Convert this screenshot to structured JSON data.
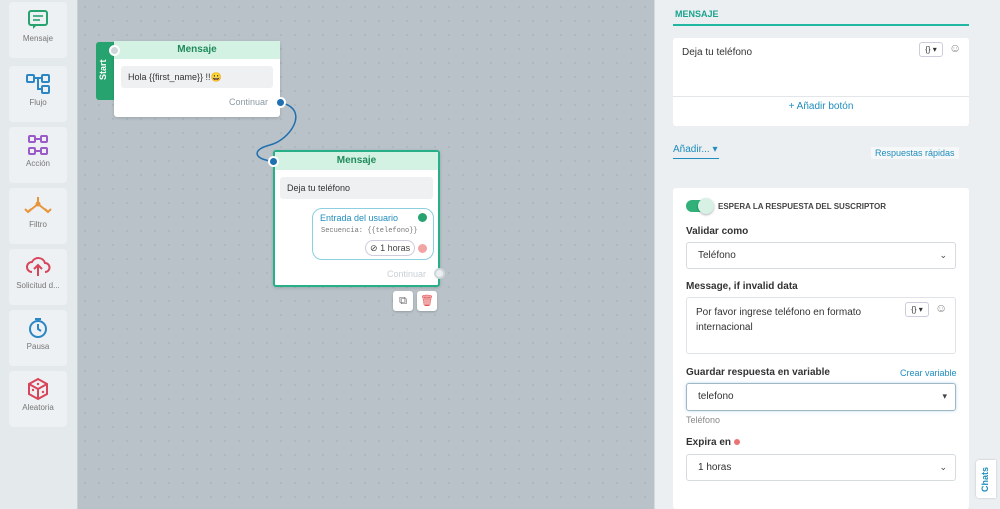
{
  "sidebar": {
    "items": [
      {
        "label": "Mensaje",
        "icon": "message-icon"
      },
      {
        "label": "Flujo",
        "icon": "flow-icon"
      },
      {
        "label": "Acción",
        "icon": "action-icon"
      },
      {
        "label": "Filtro",
        "icon": "filter-icon"
      },
      {
        "label": "Solicitud d...",
        "icon": "request-icon"
      },
      {
        "label": "Pausa",
        "icon": "pause-icon"
      },
      {
        "label": "Aleatoria",
        "icon": "random-icon"
      }
    ]
  },
  "canvas": {
    "start_label": "Start",
    "node1": {
      "title": "Mensaje",
      "text": "Hola  {{first_name}} !!😀",
      "continue_label": "Continuar"
    },
    "node2": {
      "title": "Mensaje",
      "text": "Deja tu teléfono",
      "input_title": "Entrada del usuario",
      "sequence": "Secuencia: {{telefono}}",
      "timeout": "1 horas",
      "continue_label": "Continuar"
    }
  },
  "panel": {
    "section_title": "MENSAJE",
    "message_text": "Deja tu teléfono",
    "add_button": "+ Añadir botón",
    "add_menu": "Añadir...",
    "quick_replies": "Respuestas rápidas",
    "wait_title": "ESPERA LA RESPUESTA DEL SUSCRIPTOR",
    "validate_label": "Validar como",
    "validate_value": "Teléfono",
    "invalid_label": "Message, if invalid data",
    "invalid_text": "Por favor ingrese teléfono en formato internacional",
    "save_label": "Guardar respuesta en variable",
    "create_var": "Crear variable",
    "variable_value": "telefono",
    "variable_hint": "Teléfono",
    "expires_label": "Expira en",
    "expires_value": "1 horas",
    "vars_glyph": "{}",
    "chats_tab": "Chats"
  },
  "colors": {
    "accent": "#21b6a1",
    "green": "#27a36f",
    "link": "#1f8dbd",
    "node_head": "#d4f2e4"
  }
}
